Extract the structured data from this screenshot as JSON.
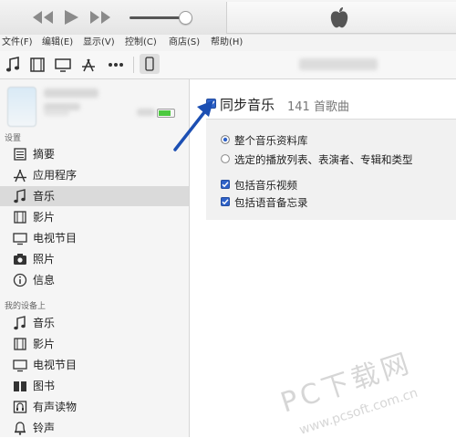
{
  "menu": [
    "文件(F)",
    "编辑(E)",
    "显示(V)",
    "控制(C)",
    "商店(S)",
    "帮助(H)"
  ],
  "sidebar": {
    "settings_title": "设置",
    "settings_items": [
      {
        "label": "摘要",
        "icon": "summary-icon"
      },
      {
        "label": "应用程序",
        "icon": "apps-icon"
      },
      {
        "label": "音乐",
        "icon": "music-note-icon",
        "selected": true
      },
      {
        "label": "影片",
        "icon": "film-icon"
      },
      {
        "label": "电视节目",
        "icon": "tv-icon"
      },
      {
        "label": "照片",
        "icon": "camera-icon"
      },
      {
        "label": "信息",
        "icon": "info-icon"
      }
    ],
    "device_title": "我的设备上",
    "device_items": [
      {
        "label": "音乐",
        "icon": "music-note-icon"
      },
      {
        "label": "影片",
        "icon": "film-icon"
      },
      {
        "label": "电视节目",
        "icon": "tv-icon"
      },
      {
        "label": "图书",
        "icon": "book-icon"
      },
      {
        "label": "有声读物",
        "icon": "audiobook-icon"
      },
      {
        "label": "铃声",
        "icon": "bell-icon"
      }
    ]
  },
  "main": {
    "sync_label": "同步音乐",
    "sync_count": "141 首歌曲",
    "sync_checked": true,
    "options": [
      {
        "type": "radio",
        "label": "整个音乐资料库",
        "checked": true
      },
      {
        "type": "radio",
        "label": "选定的播放列表、表演者、专辑和类型",
        "checked": false
      },
      {
        "type": "checkbox",
        "label": "包括音乐视频",
        "checked": true
      },
      {
        "type": "checkbox",
        "label": "包括语音备忘录",
        "checked": true
      }
    ]
  },
  "watermark": {
    "title": "PC下载网",
    "url": "www.pcsoft.com.cn"
  },
  "colors": {
    "accent": "#2f62c9",
    "arrow": "#1c4fb3",
    "selected_row": "#dadada",
    "battery": "#4cc93f"
  }
}
